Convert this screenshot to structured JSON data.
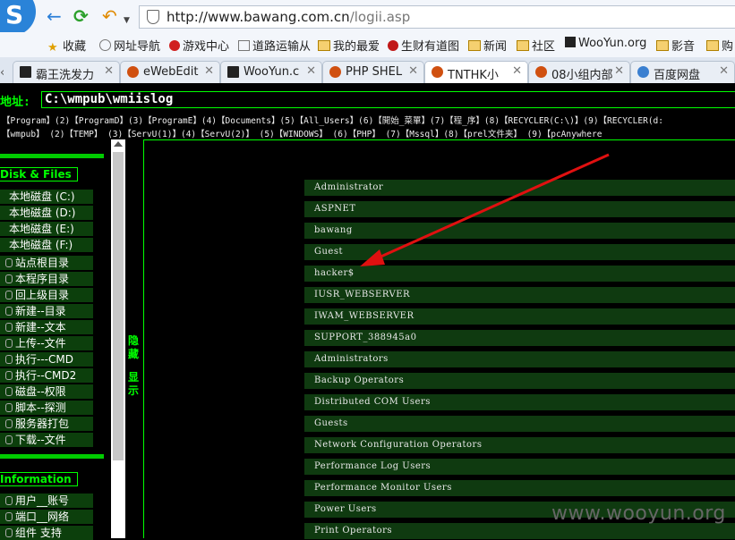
{
  "browser": {
    "url_main": "http://www.bawang.com.cn",
    "url_path": "/logii.asp",
    "bookmarks": [
      "收藏",
      "网址导航",
      "游戏中心",
      "道路运输从",
      "我的最爱",
      "生财有道图",
      "新闻",
      "社区",
      "WooYun.org",
      "影音",
      "购"
    ],
    "tabs": [
      {
        "label": "霸王洗发力"
      },
      {
        "label": "eWebEdit"
      },
      {
        "label": "WooYun.c"
      },
      {
        "label": "PHP SHEL"
      },
      {
        "label": "TNTHK小"
      },
      {
        "label": "08小组内部"
      },
      {
        "label": "百度网盘"
      }
    ]
  },
  "shell": {
    "address_label": "地址:",
    "path": "C:\\wmpub\\wmiislog",
    "shortcuts_row1": "【Program】(2)【ProgramD】(3)【ProgramE】(4)【Documents】(5)【All_Users】(6)【開始_菜單】(7)【程_序】(8)【RECYCLER(C:\\)】(9)【RECYCLER(d:",
    "shortcuts_row2": "【wmpub】  (2)【TEMP】     (3)【ServU(1)】(4)【ServU(2)】 (5)【WINDOWS】   (6)【PHP】      (7)【Mssql】(8)【prel文件夹】   (9)【pcAnywhere",
    "disk_section": "Disk & Files",
    "disk_items": [
      "本地磁盘 (C:)",
      "本地磁盘 (D:)",
      "本地磁盘 (E:)",
      "本地磁盘 (F:)"
    ],
    "file_items": [
      "站点根目录",
      "本程序目录",
      "回上级目录",
      "新建--目录",
      "新建--文本",
      "上传--文件",
      "执行---CMD",
      "执行--CMD2",
      "磁盘--权限",
      "脚本--探测",
      "服务器打包",
      "下载--文件"
    ],
    "info_section": "Information",
    "info_items": [
      "用户__账号",
      "端口__网络",
      "组件 支持"
    ],
    "toggle_hide": [
      "隐",
      "藏"
    ],
    "toggle_show": [
      "显",
      "示"
    ],
    "accounts": [
      "Administrator",
      "ASPNET",
      "bawang",
      "Guest",
      "hacker$",
      "IUSR_WEBSERVER",
      "IWAM_WEBSERVER",
      "SUPPORT_388945a0",
      "Administrators",
      "Backup Operators",
      "Distributed COM Users",
      "Guests",
      "Network Configuration Operators",
      "Performance Log Users",
      "Performance Monitor Users",
      "Power Users",
      "Print Operators"
    ]
  },
  "watermark": "www.wooyun.org",
  "colors": {
    "terminal_green": "#00ff00",
    "row_bg": "#0f3a10",
    "arrow": "#e01010"
  }
}
